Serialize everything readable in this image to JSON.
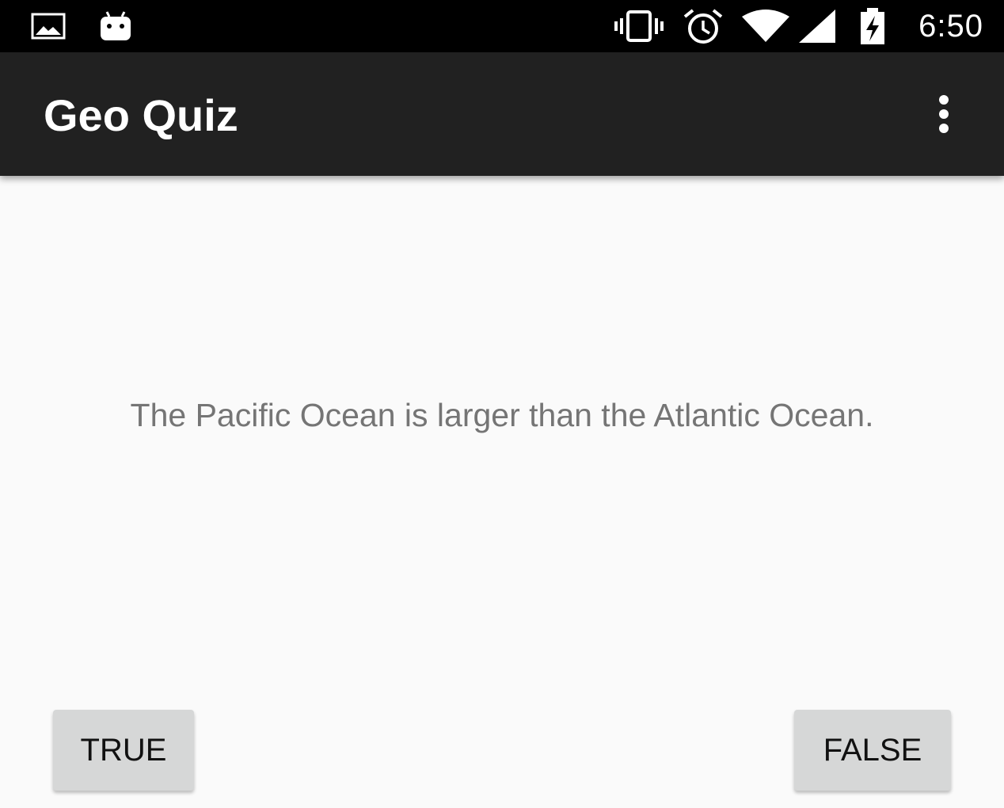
{
  "status_bar": {
    "time": "6:50",
    "left_icons": [
      "image-icon",
      "android-debug-icon"
    ],
    "right_icons": [
      "vibrate-icon",
      "alarm-icon",
      "wifi-icon",
      "cell-signal-icon",
      "battery-charging-icon"
    ]
  },
  "app_bar": {
    "title": "Geo Quiz",
    "overflow_icon": "more-vert-icon"
  },
  "question": {
    "text": "The Pacific Ocean is larger than the Atlantic Ocean."
  },
  "answers": {
    "true_label": "TRUE",
    "false_label": "FALSE"
  },
  "colors": {
    "status_bar": "#000000",
    "app_bar": "#212121",
    "background": "#fafafa",
    "question_text": "#757575",
    "button": "#d6d7d7"
  }
}
